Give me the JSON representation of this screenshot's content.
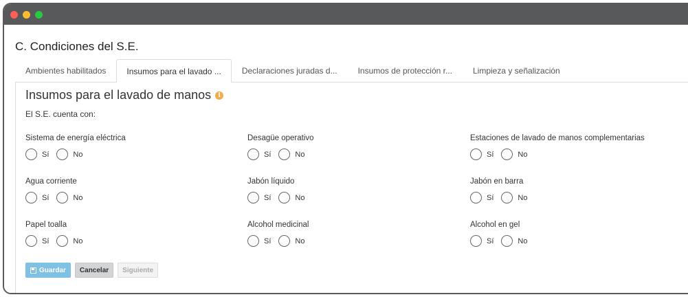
{
  "window": {
    "controls": [
      {
        "name": "close",
        "color": "#ff5f57"
      },
      {
        "name": "minimize",
        "color": "#febc2e"
      },
      {
        "name": "maximize",
        "color": "#28c840"
      }
    ]
  },
  "page": {
    "title": "C. Condiciones del S.E."
  },
  "tabs": [
    {
      "label": "Ambientes habilitados",
      "active": false
    },
    {
      "label": "Insumos para el lavado ...",
      "active": true
    },
    {
      "label": "Declaraciones juradas d...",
      "active": false
    },
    {
      "label": "Insumos de protección r...",
      "active": false
    },
    {
      "label": "Limpieza y señalización",
      "active": false
    }
  ],
  "section": {
    "title": "Insumos para el lavado de manos",
    "info_icon": "info-icon",
    "subtitle": "El S.E. cuenta con:"
  },
  "options": {
    "yes": "Sí",
    "no": "No"
  },
  "questions": [
    {
      "label": "Sistema de energía eléctrica"
    },
    {
      "label": "Desagüe operativo"
    },
    {
      "label": "Estaciones de lavado de manos complementarias"
    },
    {
      "label": "Agua corriente"
    },
    {
      "label": "Jabón líquido"
    },
    {
      "label": "Jabón en barra"
    },
    {
      "label": "Papel toalla"
    },
    {
      "label": "Alcohol medicinal"
    },
    {
      "label": "Alcohol en gel"
    }
  ],
  "buttons": {
    "save": "Guardar",
    "save_icon": "floppy-icon",
    "cancel": "Cancelar",
    "next": "Siguiente"
  },
  "colors": {
    "titlebar": "#58595b",
    "save_button": "#7fc0e5",
    "info_icon": "#f0ad4e"
  }
}
